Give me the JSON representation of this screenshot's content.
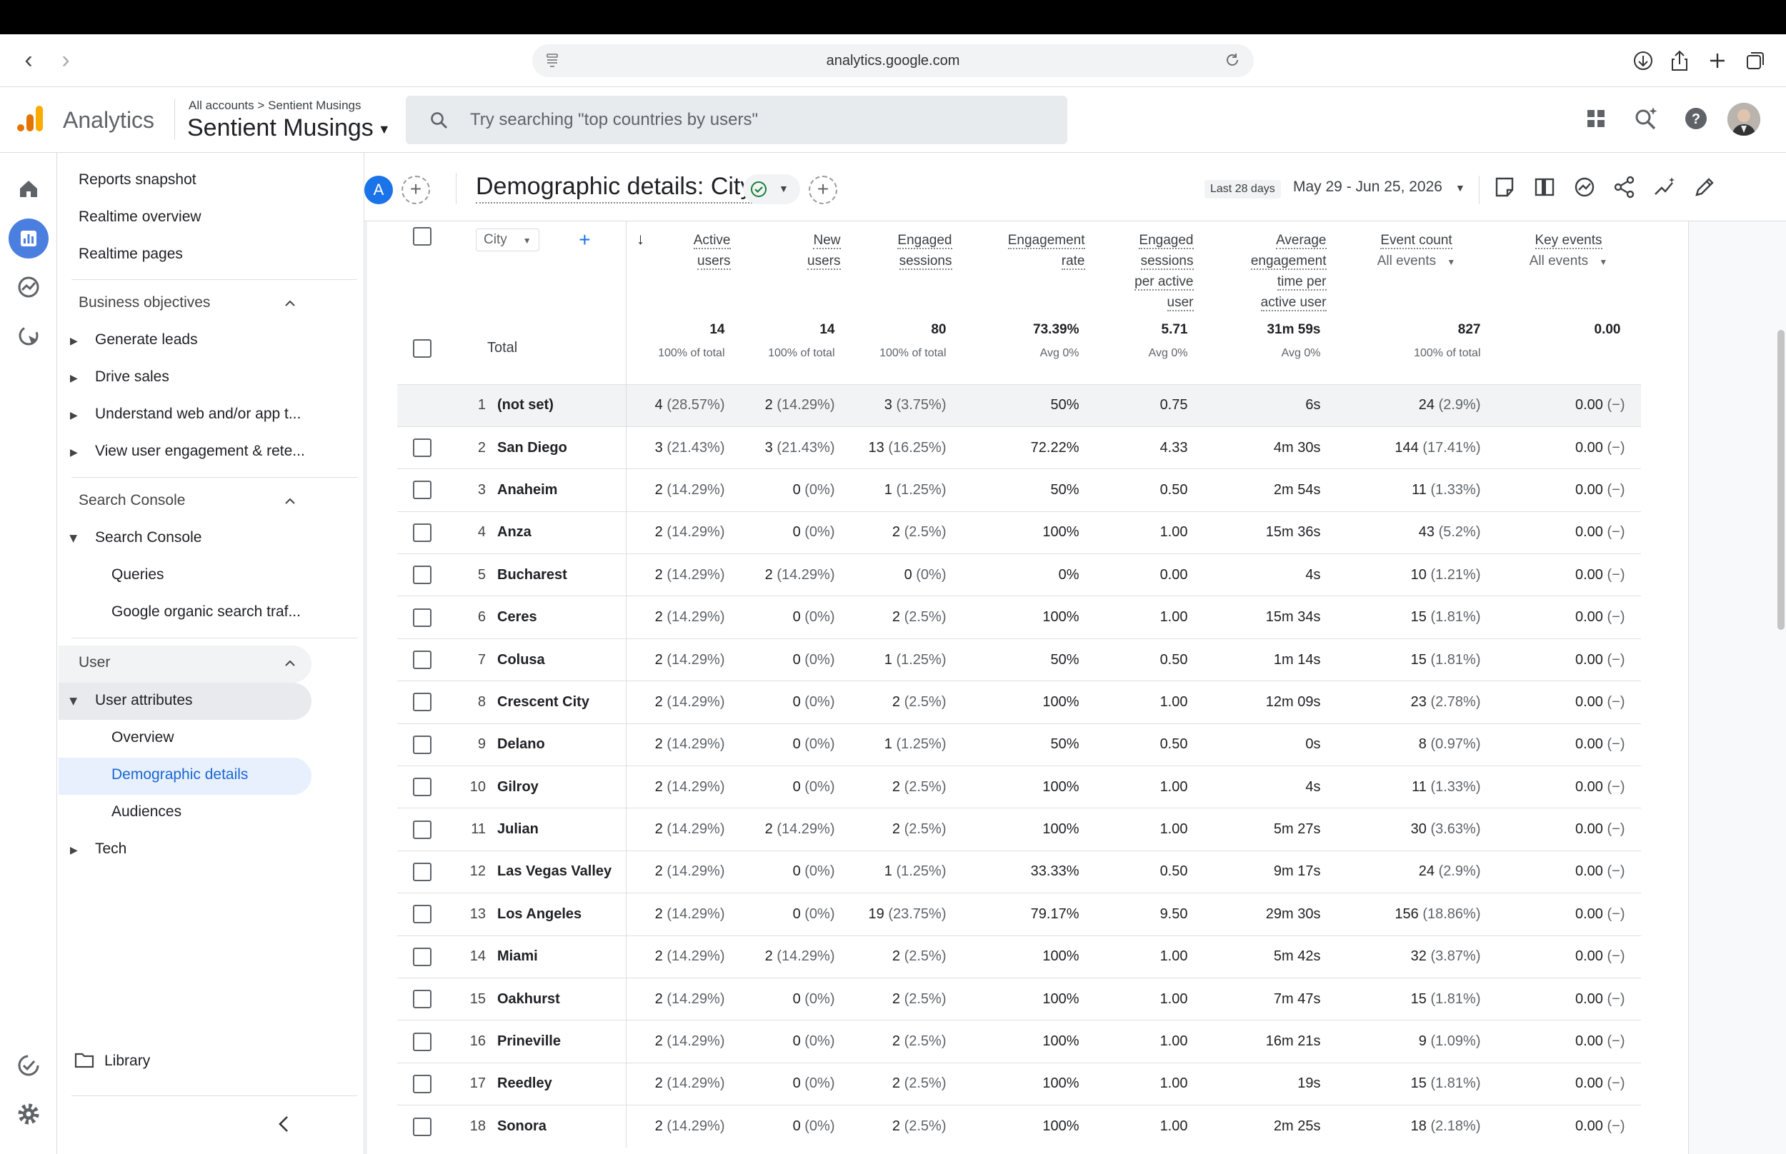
{
  "browser": {
    "url": "analytics.google.com"
  },
  "header": {
    "app_name": "Analytics",
    "breadcrumb_root": "All accounts",
    "breadcrumb_sep": ">",
    "breadcrumb_account": "Sentient Musings",
    "property": "Sentient Musings",
    "search_placeholder": "Try searching \"top countries by users\""
  },
  "sidebar": {
    "reports_snapshot": "Reports snapshot",
    "realtime_overview": "Realtime overview",
    "realtime_pages": "Realtime pages",
    "section_business": "Business objectives",
    "generate_leads": "Generate leads",
    "drive_sales": "Drive sales",
    "understand": "Understand web and/or app t...",
    "view_engagement": "View user engagement & rete...",
    "section_search_console": "Search Console",
    "search_console": "Search Console",
    "queries": "Queries",
    "google_organic": "Google organic search traf...",
    "section_user": "User",
    "user_attributes": "User attributes",
    "overview": "Overview",
    "demographic_details": "Demographic details",
    "audiences": "Audiences",
    "tech": "Tech",
    "library": "Library"
  },
  "report": {
    "avatar_letter": "A",
    "title": "Demographic details: City",
    "date_badge": "Last 28 days",
    "date_range": "May 29 - Jun 25, 2026"
  },
  "table": {
    "dimension": "City",
    "columns": {
      "active_users": [
        "Active",
        "users"
      ],
      "new_users": [
        "New",
        "users"
      ],
      "engaged_sessions": [
        "Engaged",
        "sessions"
      ],
      "engagement_rate": [
        "Engagement",
        "rate"
      ],
      "engaged_per_user": [
        "Engaged",
        "sessions",
        "per active",
        "user"
      ],
      "avg_engagement": [
        "Average",
        "engagement",
        "time per",
        "active user"
      ],
      "event_count": "Event count",
      "key_events": "Key events",
      "all_events": "All events"
    },
    "total": {
      "label": "Total",
      "active_users": "14",
      "active_users_sub": "100% of total",
      "new_users": "14",
      "new_users_sub": "100% of total",
      "engaged_sessions": "80",
      "engaged_sessions_sub": "100% of total",
      "engagement_rate": "73.39%",
      "engagement_rate_sub": "Avg 0%",
      "engaged_per_user": "5.71",
      "engaged_per_user_sub": "Avg 0%",
      "avg_engagement": "31m 59s",
      "avg_engagement_sub": "Avg 0%",
      "event_count": "827",
      "event_count_sub": "100% of total",
      "key_events": "0.00"
    },
    "rows": [
      {
        "n": "1",
        "city": "(not set)",
        "au": "4",
        "aup": "(28.57%)",
        "nu": "2",
        "nup": "(14.29%)",
        "es": "3",
        "esp": "(3.75%)",
        "er": "50%",
        "epu": "0.75",
        "aet": "6s",
        "ec": "24",
        "ecp": "(2.9%)",
        "ke": "0.00",
        "kep": "(−)"
      },
      {
        "n": "2",
        "city": "San Diego",
        "au": "3",
        "aup": "(21.43%)",
        "nu": "3",
        "nup": "(21.43%)",
        "es": "13",
        "esp": "(16.25%)",
        "er": "72.22%",
        "epu": "4.33",
        "aet": "4m 30s",
        "ec": "144",
        "ecp": "(17.41%)",
        "ke": "0.00",
        "kep": "(−)"
      },
      {
        "n": "3",
        "city": "Anaheim",
        "au": "2",
        "aup": "(14.29%)",
        "nu": "0",
        "nup": "(0%)",
        "es": "1",
        "esp": "(1.25%)",
        "er": "50%",
        "epu": "0.50",
        "aet": "2m 54s",
        "ec": "11",
        "ecp": "(1.33%)",
        "ke": "0.00",
        "kep": "(−)"
      },
      {
        "n": "4",
        "city": "Anza",
        "au": "2",
        "aup": "(14.29%)",
        "nu": "0",
        "nup": "(0%)",
        "es": "2",
        "esp": "(2.5%)",
        "er": "100%",
        "epu": "1.00",
        "aet": "15m 36s",
        "ec": "43",
        "ecp": "(5.2%)",
        "ke": "0.00",
        "kep": "(−)"
      },
      {
        "n": "5",
        "city": "Bucharest",
        "au": "2",
        "aup": "(14.29%)",
        "nu": "2",
        "nup": "(14.29%)",
        "es": "0",
        "esp": "(0%)",
        "er": "0%",
        "epu": "0.00",
        "aet": "4s",
        "ec": "10",
        "ecp": "(1.21%)",
        "ke": "0.00",
        "kep": "(−)"
      },
      {
        "n": "6",
        "city": "Ceres",
        "au": "2",
        "aup": "(14.29%)",
        "nu": "0",
        "nup": "(0%)",
        "es": "2",
        "esp": "(2.5%)",
        "er": "100%",
        "epu": "1.00",
        "aet": "15m 34s",
        "ec": "15",
        "ecp": "(1.81%)",
        "ke": "0.00",
        "kep": "(−)"
      },
      {
        "n": "7",
        "city": "Colusa",
        "au": "2",
        "aup": "(14.29%)",
        "nu": "0",
        "nup": "(0%)",
        "es": "1",
        "esp": "(1.25%)",
        "er": "50%",
        "epu": "0.50",
        "aet": "1m 14s",
        "ec": "15",
        "ecp": "(1.81%)",
        "ke": "0.00",
        "kep": "(−)"
      },
      {
        "n": "8",
        "city": "Crescent City",
        "au": "2",
        "aup": "(14.29%)",
        "nu": "0",
        "nup": "(0%)",
        "es": "2",
        "esp": "(2.5%)",
        "er": "100%",
        "epu": "1.00",
        "aet": "12m 09s",
        "ec": "23",
        "ecp": "(2.78%)",
        "ke": "0.00",
        "kep": "(−)"
      },
      {
        "n": "9",
        "city": "Delano",
        "au": "2",
        "aup": "(14.29%)",
        "nu": "0",
        "nup": "(0%)",
        "es": "1",
        "esp": "(1.25%)",
        "er": "50%",
        "epu": "0.50",
        "aet": "0s",
        "ec": "8",
        "ecp": "(0.97%)",
        "ke": "0.00",
        "kep": "(−)"
      },
      {
        "n": "10",
        "city": "Gilroy",
        "au": "2",
        "aup": "(14.29%)",
        "nu": "0",
        "nup": "(0%)",
        "es": "2",
        "esp": "(2.5%)",
        "er": "100%",
        "epu": "1.00",
        "aet": "4s",
        "ec": "11",
        "ecp": "(1.33%)",
        "ke": "0.00",
        "kep": "(−)"
      },
      {
        "n": "11",
        "city": "Julian",
        "au": "2",
        "aup": "(14.29%)",
        "nu": "2",
        "nup": "(14.29%)",
        "es": "2",
        "esp": "(2.5%)",
        "er": "100%",
        "epu": "1.00",
        "aet": "5m 27s",
        "ec": "30",
        "ecp": "(3.63%)",
        "ke": "0.00",
        "kep": "(−)"
      },
      {
        "n": "12",
        "city": "Las Vegas Valley",
        "au": "2",
        "aup": "(14.29%)",
        "nu": "0",
        "nup": "(0%)",
        "es": "1",
        "esp": "(1.25%)",
        "er": "33.33%",
        "epu": "0.50",
        "aet": "9m 17s",
        "ec": "24",
        "ecp": "(2.9%)",
        "ke": "0.00",
        "kep": "(−)"
      },
      {
        "n": "13",
        "city": "Los Angeles",
        "au": "2",
        "aup": "(14.29%)",
        "nu": "0",
        "nup": "(0%)",
        "es": "19",
        "esp": "(23.75%)",
        "er": "79.17%",
        "epu": "9.50",
        "aet": "29m 30s",
        "ec": "156",
        "ecp": "(18.86%)",
        "ke": "0.00",
        "kep": "(−)"
      },
      {
        "n": "14",
        "city": "Miami",
        "au": "2",
        "aup": "(14.29%)",
        "nu": "2",
        "nup": "(14.29%)",
        "es": "2",
        "esp": "(2.5%)",
        "er": "100%",
        "epu": "1.00",
        "aet": "5m 42s",
        "ec": "32",
        "ecp": "(3.87%)",
        "ke": "0.00",
        "kep": "(−)"
      },
      {
        "n": "15",
        "city": "Oakhurst",
        "au": "2",
        "aup": "(14.29%)",
        "nu": "0",
        "nup": "(0%)",
        "es": "2",
        "esp": "(2.5%)",
        "er": "100%",
        "epu": "1.00",
        "aet": "7m 47s",
        "ec": "15",
        "ecp": "(1.81%)",
        "ke": "0.00",
        "kep": "(−)"
      },
      {
        "n": "16",
        "city": "Prineville",
        "au": "2",
        "aup": "(14.29%)",
        "nu": "0",
        "nup": "(0%)",
        "es": "2",
        "esp": "(2.5%)",
        "er": "100%",
        "epu": "1.00",
        "aet": "16m 21s",
        "ec": "9",
        "ecp": "(1.09%)",
        "ke": "0.00",
        "kep": "(−)"
      },
      {
        "n": "17",
        "city": "Reedley",
        "au": "2",
        "aup": "(14.29%)",
        "nu": "0",
        "nup": "(0%)",
        "es": "2",
        "esp": "(2.5%)",
        "er": "100%",
        "epu": "1.00",
        "aet": "19s",
        "ec": "15",
        "ecp": "(1.81%)",
        "ke": "0.00",
        "kep": "(−)"
      },
      {
        "n": "18",
        "city": "Sonora",
        "au": "2",
        "aup": "(14.29%)",
        "nu": "0",
        "nup": "(0%)",
        "es": "2",
        "esp": "(2.5%)",
        "er": "100%",
        "epu": "1.00",
        "aet": "2m 25s",
        "ec": "18",
        "ecp": "(2.18%)",
        "ke": "0.00",
        "kep": "(−)"
      }
    ]
  },
  "colors": {
    "accent": "#1a73e8",
    "nav_active_bg": "#e8f0fe",
    "nav_active_text": "#1967d2",
    "rail_active": "#4a7fe0",
    "logo_orange": "#f9ab00",
    "logo_dark_orange": "#e37400"
  }
}
